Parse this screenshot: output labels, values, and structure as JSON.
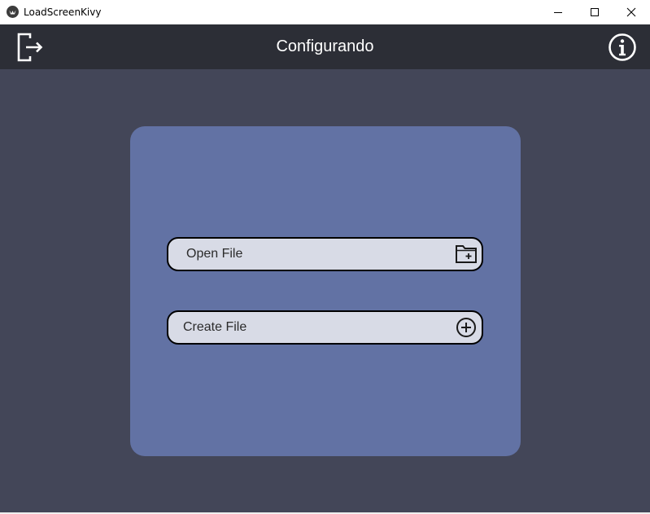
{
  "window": {
    "title": "LoadScreenKivy",
    "controls": {
      "minimize": "minimize-icon",
      "maximize": "maximize-icon",
      "close": "close-icon"
    }
  },
  "appbar": {
    "title": "Configurando",
    "left_icon": "exit-icon",
    "right_icon": "info-icon",
    "background": "#2c2e36"
  },
  "card": {
    "background": "#6272a4",
    "buttons": [
      {
        "label": "Open File",
        "icon": "folder-plus-icon"
      },
      {
        "label": "Create File",
        "icon": "plus-circle-icon"
      }
    ]
  },
  "colors": {
    "app_background": "#434658",
    "button_fill": "#d8dbe6",
    "button_border": "#000000"
  }
}
